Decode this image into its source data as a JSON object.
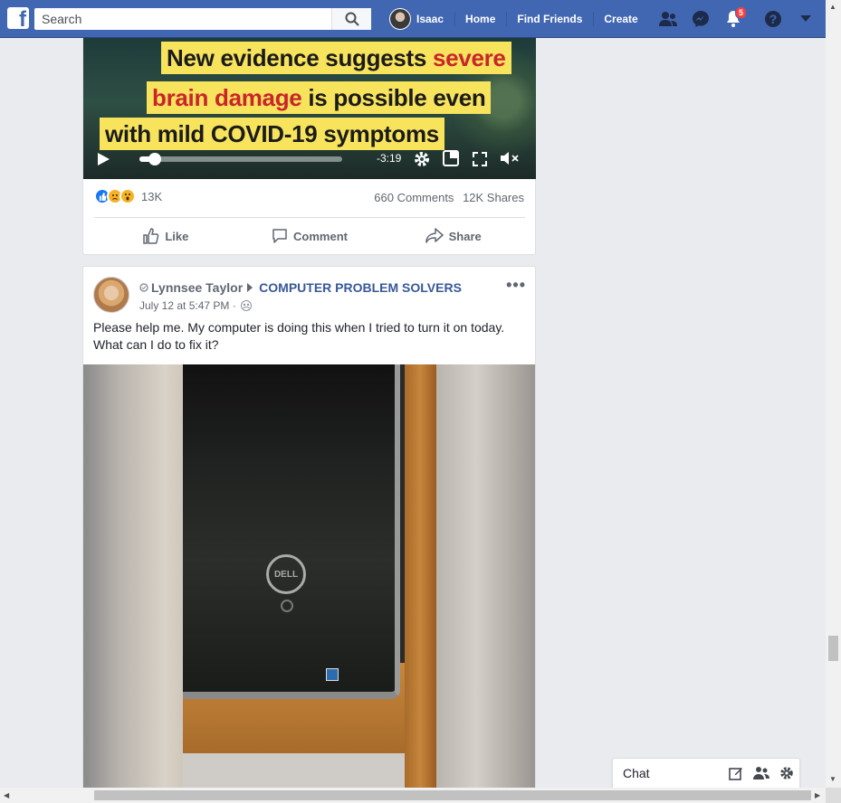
{
  "header": {
    "search_placeholder": "Search",
    "user_name": "Isaac",
    "nav": [
      "Home",
      "Find Friends",
      "Create"
    ],
    "notifications_count": "5"
  },
  "video_post": {
    "headline_lines": [
      {
        "before": "New evidence suggests ",
        "highlight": "severe",
        "after": ""
      },
      {
        "before": "",
        "highlight": "brain damage",
        "after": " is possible even"
      },
      {
        "before": "with mild COVID-19 symptoms",
        "highlight": "",
        "after": ""
      }
    ],
    "time_remaining": "-3:19",
    "progress_fraction": 0.1,
    "reaction_count": "13K",
    "comments": "660 Comments",
    "shares": "12K Shares",
    "actions": {
      "like": "Like",
      "comment": "Comment",
      "share": "Share"
    }
  },
  "group_post": {
    "author": "Lynnsee Taylor",
    "group": "COMPUTER PROBLEM SOLVERS",
    "timestamp": "July 12 at 5:47 PM ·",
    "more": "•••",
    "text": "Please help me. My computer is doing this when I tried to turn it on today. What can I do to fix it?",
    "image_logo": "DELL"
  },
  "chat": {
    "label": "Chat"
  },
  "colors": {
    "brand": "#4267b2",
    "link": "#385898",
    "headline_bg": "#f7e35c",
    "headline_red": "#c9252c",
    "badge": "#fa3e3e"
  }
}
